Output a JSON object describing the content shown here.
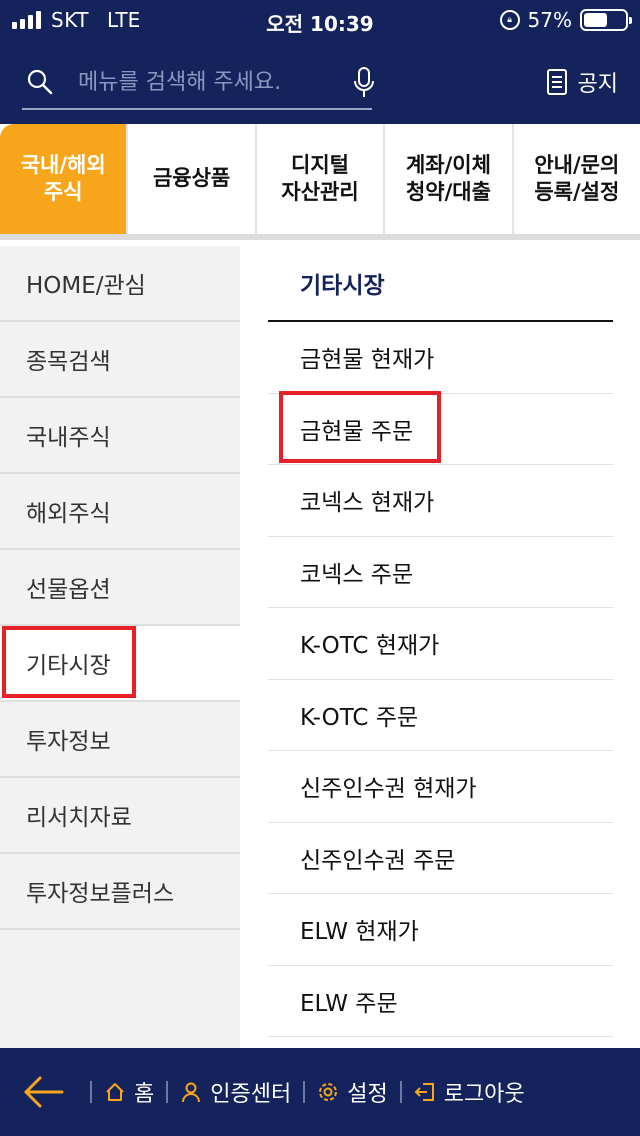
{
  "status_bar": {
    "carrier": "SKT",
    "network": "LTE",
    "time": "오전 10:39",
    "battery": "57%",
    "battery_level": 0.57
  },
  "header": {
    "search_placeholder": "메뉴를 검색해 주세요.",
    "notice_label": "공지"
  },
  "tabs": [
    {
      "line1": "국내/해외",
      "line2": "주식"
    },
    {
      "line1": "금융상품",
      "line2": ""
    },
    {
      "line1": "디지털",
      "line2": "자산관리"
    },
    {
      "line1": "계좌/이체",
      "line2": "청약/대출"
    },
    {
      "line1": "안내/문의",
      "line2": "등록/설정"
    }
  ],
  "side_menu": [
    "HOME/관심",
    "종목검색",
    "국내주식",
    "해외주식",
    "선물옵션",
    "기타시장",
    "투자정보",
    "리서치자료",
    "투자정보플러스"
  ],
  "sub_menu": {
    "title": "기타시장",
    "items": [
      "금현물 현재가",
      "금현물 주문",
      "코넥스 현재가",
      "코넥스 주문",
      "K-OTC 현재가",
      "K-OTC 주문",
      "신주인수권 현재가",
      "신주인수권 주문",
      "ELW 현재가",
      "ELW 주문"
    ]
  },
  "bottom_bar": {
    "home": "홈",
    "auth": "인증센터",
    "settings": "설정",
    "logout": "로그아웃"
  },
  "colors": {
    "navy": "#14235c",
    "accent_orange": "#f7a61c",
    "highlight_red": "#e8202a",
    "icon_orange": "#f7a61c"
  },
  "icons": [
    "search-icon",
    "mic-icon",
    "notice-icon",
    "back-arrow-icon",
    "home-icon",
    "person-icon",
    "gear-icon",
    "logout-icon",
    "signal-icon",
    "lock-rotation-icon",
    "battery-icon"
  ]
}
